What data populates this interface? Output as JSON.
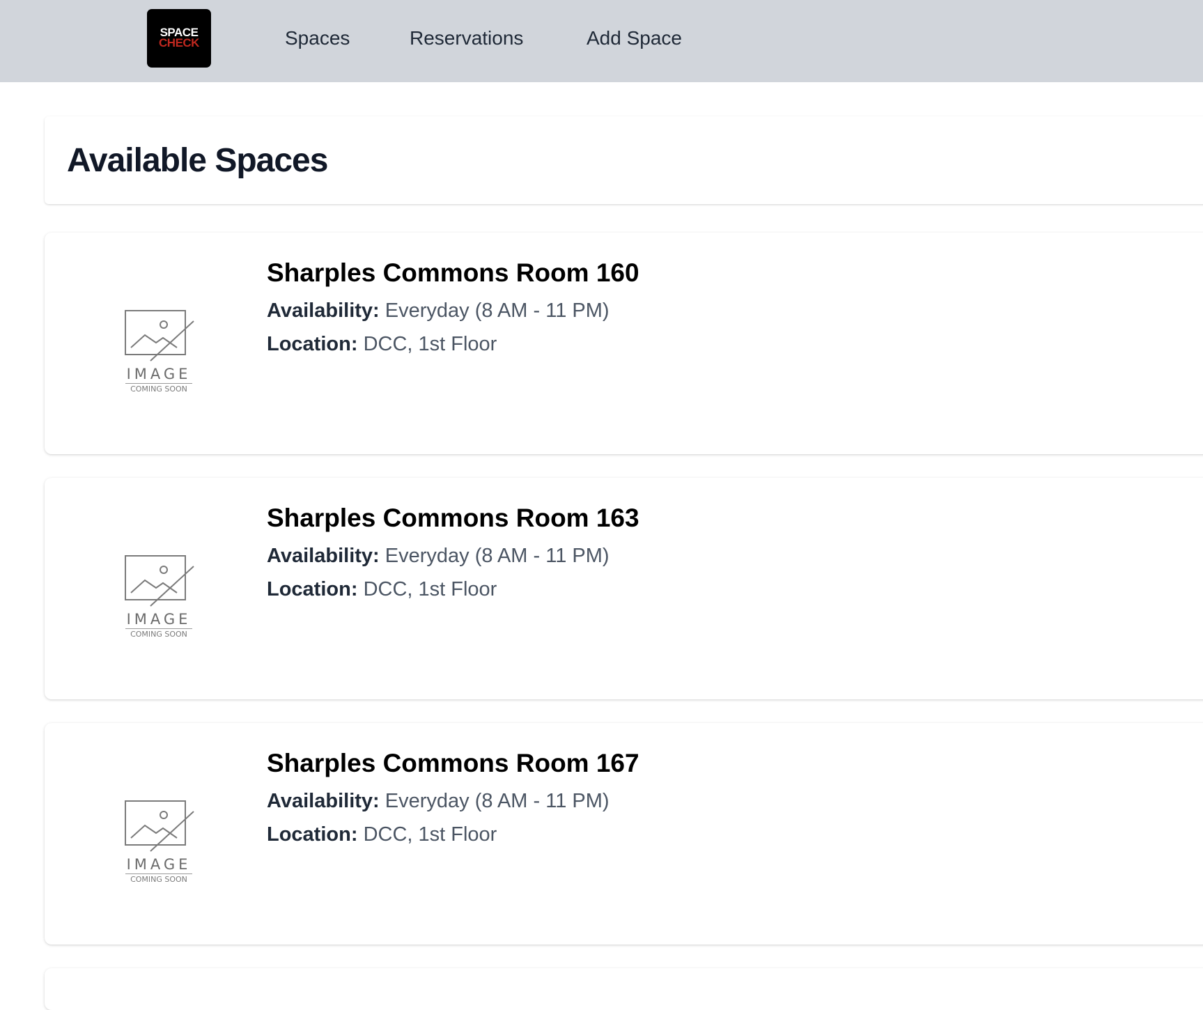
{
  "navbar": {
    "logo": {
      "line1": "SPACE",
      "line2": "CHECK"
    },
    "links": [
      {
        "label": "Spaces"
      },
      {
        "label": "Reservations"
      },
      {
        "label": "Add Space"
      }
    ]
  },
  "page": {
    "title": "Available Spaces"
  },
  "placeholder": {
    "main": "IMAGE",
    "sub": "COMING SOON",
    "icon": "image-placeholder-icon"
  },
  "spaces": [
    {
      "name": "Sharples Commons Room 160",
      "availability_label": "Availability:",
      "availability": "Everyday (8 AM - 11 PM)",
      "location_label": "Location:",
      "location": "DCC, 1st Floor"
    },
    {
      "name": "Sharples Commons Room 163",
      "availability_label": "Availability:",
      "availability": "Everyday (8 AM - 11 PM)",
      "location_label": "Location:",
      "location": "DCC, 1st Floor"
    },
    {
      "name": "Sharples Commons Room 167",
      "availability_label": "Availability:",
      "availability": "Everyday (8 AM - 11 PM)",
      "location_label": "Location:",
      "location": "DCC, 1st Floor"
    }
  ],
  "colors": {
    "navbar_bg": "#d1d5db",
    "logo_bg": "#000000",
    "logo_accent": "#c0281f",
    "text_primary": "#111827",
    "text_secondary": "#4b5563"
  }
}
